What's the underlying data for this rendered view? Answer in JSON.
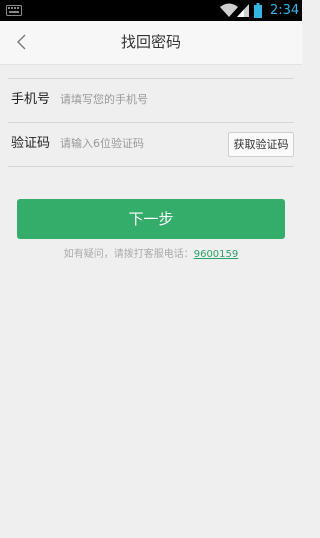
{
  "status_bar": {
    "time": "2:34",
    "icons": [
      "keyboard-icon",
      "wifi-icon",
      "signal-icon",
      "battery-icon"
    ],
    "time_color": "#33b5e5"
  },
  "header": {
    "title": "找回密码",
    "back_icon": "chevron-left-icon"
  },
  "form": {
    "phone": {
      "label": "手机号",
      "placeholder": "请填写您的手机号"
    },
    "code": {
      "label": "验证码",
      "placeholder": "请输入6位验证码",
      "button": "获取验证码"
    }
  },
  "actions": {
    "next_label": "下一步",
    "accent_color": "#35ad6a"
  },
  "help": {
    "text": "如有疑问，请拨打客服电话：",
    "phone": "9600159"
  }
}
